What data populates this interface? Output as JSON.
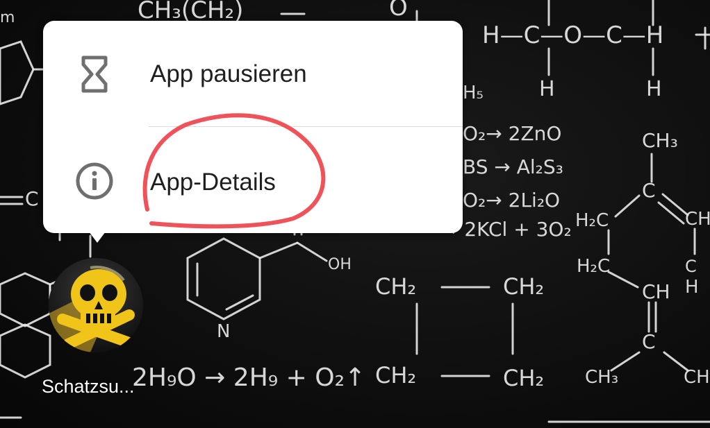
{
  "popup_menu": {
    "items": [
      {
        "label": "App pausieren",
        "icon": "hourglass-icon"
      },
      {
        "label": "App-Details",
        "icon": "info-icon"
      }
    ]
  },
  "app": {
    "label": "Schatzsu...",
    "icon": "skull-crossbones-icon"
  },
  "colors": {
    "popup_bg": "#ffffff",
    "menu_text": "#1f1f1f",
    "icon_gray": "#6f6f6f",
    "annotation_red": "#f0525a",
    "wallpaper_chalk": "#e9e9e9",
    "app_icon_yellow": "#f0c419"
  },
  "wallpaper": {
    "formulas": [
      "m",
      "CH₃(CH₂)",
      "O",
      "H—C—O—C—H",
      "H",
      "H",
      "H₅",
      "O₂→ 2ZnO",
      "BS → Al₂S₃",
      "O₂→ 2Li₂O",
      "→ 2KCl + 3O₂",
      "CH₃",
      "C",
      "H₂C",
      "H₂C",
      "CH",
      "CH",
      "C",
      "CH₃",
      "CH",
      "H",
      "C",
      "OH",
      "N",
      "CH₂",
      "CH₂",
      "CH₂",
      "CH₂",
      "2H₉O → 2H₉ + O₂↑",
      "C"
    ]
  }
}
